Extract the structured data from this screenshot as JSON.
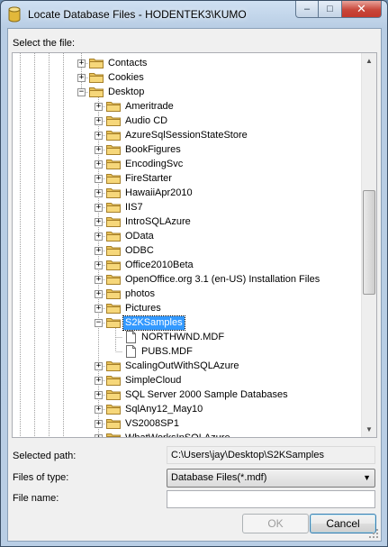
{
  "window": {
    "title": "Locate Database Files - HODENTEK3\\KUMO",
    "minimize_glyph": "–",
    "maximize_glyph": "□",
    "close_glyph": "✕"
  },
  "select_file_label": "Select the file:",
  "tree": {
    "items": [
      {
        "label": "Contacts",
        "kind": "folder",
        "expander": "+",
        "selected": false
      },
      {
        "label": "Cookies",
        "kind": "folder",
        "expander": "+",
        "selected": false
      },
      {
        "label": "Desktop",
        "kind": "folder",
        "expander": "−",
        "selected": false
      },
      {
        "label": "Ameritrade",
        "kind": "folder",
        "expander": "+",
        "selected": false
      },
      {
        "label": "Audio CD",
        "kind": "folder",
        "expander": "+",
        "selected": false
      },
      {
        "label": "AzureSqlSessionStateStore",
        "kind": "folder",
        "expander": "+",
        "selected": false
      },
      {
        "label": "BookFigures",
        "kind": "folder",
        "expander": "+",
        "selected": false
      },
      {
        "label": "EncodingSvc",
        "kind": "folder",
        "expander": "+",
        "selected": false
      },
      {
        "label": "FireStarter",
        "kind": "folder",
        "expander": "+",
        "selected": false
      },
      {
        "label": "HawaiiApr2010",
        "kind": "folder",
        "expander": "+",
        "selected": false
      },
      {
        "label": "IIS7",
        "kind": "folder",
        "expander": "+",
        "selected": false
      },
      {
        "label": "IntroSQLAzure",
        "kind": "folder",
        "expander": "+",
        "selected": false
      },
      {
        "label": "OData",
        "kind": "folder",
        "expander": "+",
        "selected": false
      },
      {
        "label": "ODBC",
        "kind": "folder",
        "expander": "+",
        "selected": false
      },
      {
        "label": "Office2010Beta",
        "kind": "folder",
        "expander": "+",
        "selected": false
      },
      {
        "label": "OpenOffice.org 3.1 (en-US) Installation Files",
        "kind": "folder",
        "expander": "+",
        "selected": false
      },
      {
        "label": "photos",
        "kind": "folder",
        "expander": "+",
        "selected": false
      },
      {
        "label": "Pictures",
        "kind": "folder",
        "expander": "+",
        "selected": false
      },
      {
        "label": "S2KSamples",
        "kind": "folder",
        "expander": "−",
        "selected": true
      },
      {
        "label": "NORTHWND.MDF",
        "kind": "file",
        "expander": "",
        "selected": false
      },
      {
        "label": "PUBS.MDF",
        "kind": "file",
        "expander": "",
        "selected": false
      },
      {
        "label": "ScalingOutWithSQLAzure",
        "kind": "folder",
        "expander": "+",
        "selected": false
      },
      {
        "label": "SimpleCloud",
        "kind": "folder",
        "expander": "+",
        "selected": false
      },
      {
        "label": "SQL Server 2000 Sample Databases",
        "kind": "folder",
        "expander": "+",
        "selected": false
      },
      {
        "label": "SqlAny12_May10",
        "kind": "folder",
        "expander": "+",
        "selected": false
      },
      {
        "label": "VS2008SP1",
        "kind": "folder",
        "expander": "+",
        "selected": false
      },
      {
        "label": "WhatWorksInSQLAzure",
        "kind": "folder",
        "expander": "+",
        "selected": false
      }
    ]
  },
  "selected_path": {
    "label": "Selected path:",
    "value": "C:\\Users\\jay\\Desktop\\S2KSamples"
  },
  "files_of_type": {
    "label": "Files of type:",
    "value": "Database Files(*.mdf)"
  },
  "file_name": {
    "label": "File name:",
    "value": ""
  },
  "buttons": {
    "ok": "OK",
    "cancel": "Cancel"
  },
  "scrollbar": {
    "up_glyph": "▲",
    "down_glyph": "▼"
  },
  "colors": {
    "selection": "#3399ff",
    "folder": "#e8c25a"
  }
}
